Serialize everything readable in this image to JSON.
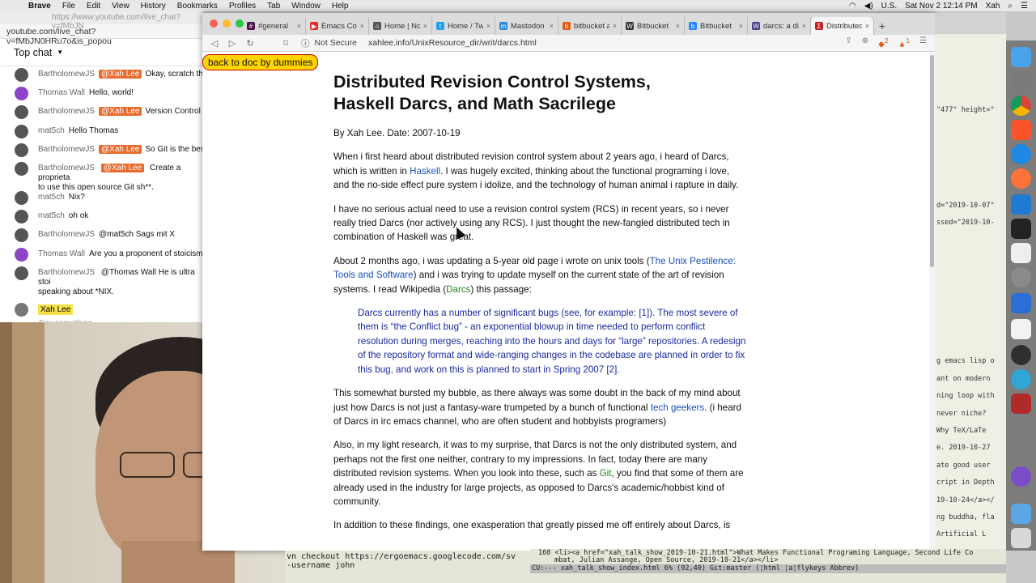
{
  "menubar": {
    "apple": "",
    "app": "Brave",
    "items": [
      "File",
      "Edit",
      "View",
      "History",
      "Bookmarks",
      "Profiles",
      "Tab",
      "Window",
      "Help"
    ],
    "input_source": "U.S.",
    "datetime": "Sat Nov 2  12:14 PM",
    "user": "Xah"
  },
  "ytchat": {
    "url1": "https://www.youtube.com/live_chat?v=fMbJN",
    "url2": "youtube.com/live_chat?v=fMbJN0HRu7o&is_popou",
    "header": "Top chat",
    "messages": [
      {
        "author": "BartholomewJS",
        "mention": "@Xah Lee",
        "text": "Okay, scratch the \""
      },
      {
        "author": "Thomas Wall",
        "mention": "",
        "text": "Hello, world!"
      },
      {
        "author": "BartholomewJS",
        "mention": "@Xah Lee",
        "text": "Version Control Sy"
      },
      {
        "author": "mat5ch",
        "mention": "",
        "text": "Hello Thomas"
      },
      {
        "author": "BartholomewJS",
        "mention": "@Xah Lee",
        "text": "So Git is the best"
      },
      {
        "author": "BartholomewJS",
        "mention": "@Xah Lee",
        "text": "Create a proprieta",
        "text2": "to use this open source Git sh**."
      },
      {
        "author": "mat5ch",
        "mention": "",
        "text": "Nix?"
      },
      {
        "author": "mat5ch",
        "mention": "",
        "text": "oh ok"
      },
      {
        "author": "BartholomewJS",
        "mention": "",
        "text": "@mat5ch Sags mit X"
      },
      {
        "author": "Thomas Wall",
        "mention": "",
        "text": "Are you a proponent of stoicism,"
      },
      {
        "author": "BartholomewJS",
        "mention": "",
        "text": "@Thomas Wall He is ultra stoi",
        "text2": "speaking about *NIX."
      }
    ],
    "self_name": "Xah Lee",
    "input_placeholder": "Say something..."
  },
  "browser": {
    "tabs": [
      {
        "label": "#general",
        "color": "#4a154b",
        "glyph": "#"
      },
      {
        "label": "Emacs Con",
        "color": "#e52d27",
        "glyph": "▶"
      },
      {
        "label": "Home | No",
        "color": "#555555",
        "glyph": "⌂"
      },
      {
        "label": "Home / Tw",
        "color": "#1da1f2",
        "glyph": "t"
      },
      {
        "label": "Mastodon",
        "color": "#3088d4",
        "glyph": "m"
      },
      {
        "label": "bitbucket a",
        "color": "#e05a1a",
        "glyph": "b"
      },
      {
        "label": "Bitbucket",
        "color": "#333333",
        "glyph": "W"
      },
      {
        "label": "Bitbucket",
        "color": "#2684ff",
        "glyph": "b"
      },
      {
        "label": "darcs: a di",
        "color": "#4b3a8c",
        "glyph": "W"
      },
      {
        "label": "Distributed",
        "color": "#c02020",
        "glyph": "Σ",
        "active": true
      }
    ],
    "new_tab": "+",
    "security": "Not Secure",
    "url": "xahlee.info/UnixResource_dir/writ/darcs.html",
    "shield_count": "2",
    "rewards_count": "1"
  },
  "article": {
    "back_link": "back to doc by dummies",
    "title_line1": "Distributed Revision Control Systems,",
    "title_line2": "Haskell Darcs, and Math Sacrilege",
    "byline": "By Xah Lee. Date: 2007-10-19",
    "p1_a": "When i first heard about distributed revision control system about 2 years ago, i heard of Darcs, which is written in ",
    "p1_link": "Haskell",
    "p1_b": ". I was hugely excited, thinking about the functional programing i love, and the no-side effect pure system i idolize, and the technology of human animal i rapture in daily.",
    "p2": "I have no serious actual need to use a revision control system (RCS) in recent years, so i never really tried Darcs (nor actively using any RCS). I just thought the new-fangled distributed tech in combination of Haskell was great.",
    "p3_a": "About 2 months ago, i was updating a 5-year old page i wrote on unix tools (",
    "p3_link": "The Unix Pestilence: Tools and Software",
    "p3_b": ") and i was trying to update myself on the current state of the art of revision systems. I read Wikipedia (",
    "p3_link2": "Darcs",
    "p3_c": ") this passage:",
    "quote": "Darcs currently has a number of significant bugs (see, for example: [1]). The most severe of them is “the Conflict bug” - an exponential blowup in time needed to perform conflict resolution during merges, reaching into the hours and days for “large” repositories. A redesign of the repository format and wide-ranging changes in the codebase are planned in order to fix this bug, and work on this is planned to start in Spring 2007 [2].",
    "p4_a": "This somewhat bursted my bubble, as there always was some doubt in the back of my mind about just how Darcs is not just a fantasy-ware trumpeted by a bunch of functional ",
    "p4_link": "tech geekers",
    "p4_b": ". (i heard of Darcs in irc emacs channel, who are often student and hobbyists programers)",
    "p5_a": "Also, in my light research, it was to my surprise, that Darcs is not the only distributed system, and perhaps not the first one neither, contrary to my impressions. In fact, today there are many distributed revision systems. When you look into these, such as ",
    "p5_link": "Git",
    "p5_b": ", you find that some of them are already used in the industry for large projects, as opposed to Darcs's academic/hobbist kind of community.",
    "p6": "In addition to these findings, one exasperation that greatly pissed me off entirely about Darcs, is"
  },
  "right_pane": {
    "lines": [
      "\"477\" height=\"",
      "d=\"2019-10-07\"",
      "ssed=\"2019-10-",
      "g emacs lisp o",
      "ant on modern",
      "ning loop with",
      "never niche?",
      "  Why TeX/LaTe",
      "e. 2019-10-27",
      "ate good user",
      "cript in Depth",
      "19-10-24</a></",
      "ng buddha, fla",
      "  Artificial L"
    ]
  },
  "bottom": {
    "terminal_text": "vn checkout https://ergoemacs.googlecode.com/sv\n-username john",
    "emacs_line1": "160 <li><a href=\"xah_talk_show_2019-10-21.html\">What Makes Functional Programing Language, Second Life Co",
    "emacs_line2": "mbat, Julian Assange, Open Source, 2019-10-21</a></li>",
    "modeline": "CU:---  xah_talk_show_index.html    6% (92,40)   Git:master  (¦html ¦a¦flykeys Abbrev)"
  },
  "colors": {
    "link": "#1a4fb5",
    "link_green": "#1e8a1e",
    "quote": "#1a2a9a",
    "back_button_bg": "#ffd400",
    "back_button_border": "#c90000",
    "mention_bg": "#e96a2d"
  },
  "dock": {
    "icons": [
      "finder-icon",
      "launchpad-icon",
      "chrome-icon",
      "brave-icon",
      "safari-icon",
      "firefox-icon",
      "vscode-icon",
      "terminal-icon",
      "textedit-icon",
      "system-prefs-icon",
      "activity-monitor-icon",
      "calendar-icon",
      "obs-icon",
      "edge-icon",
      "photo-booth-icon",
      "emacs-icon",
      "folder-icon",
      "trash-icon"
    ]
  }
}
